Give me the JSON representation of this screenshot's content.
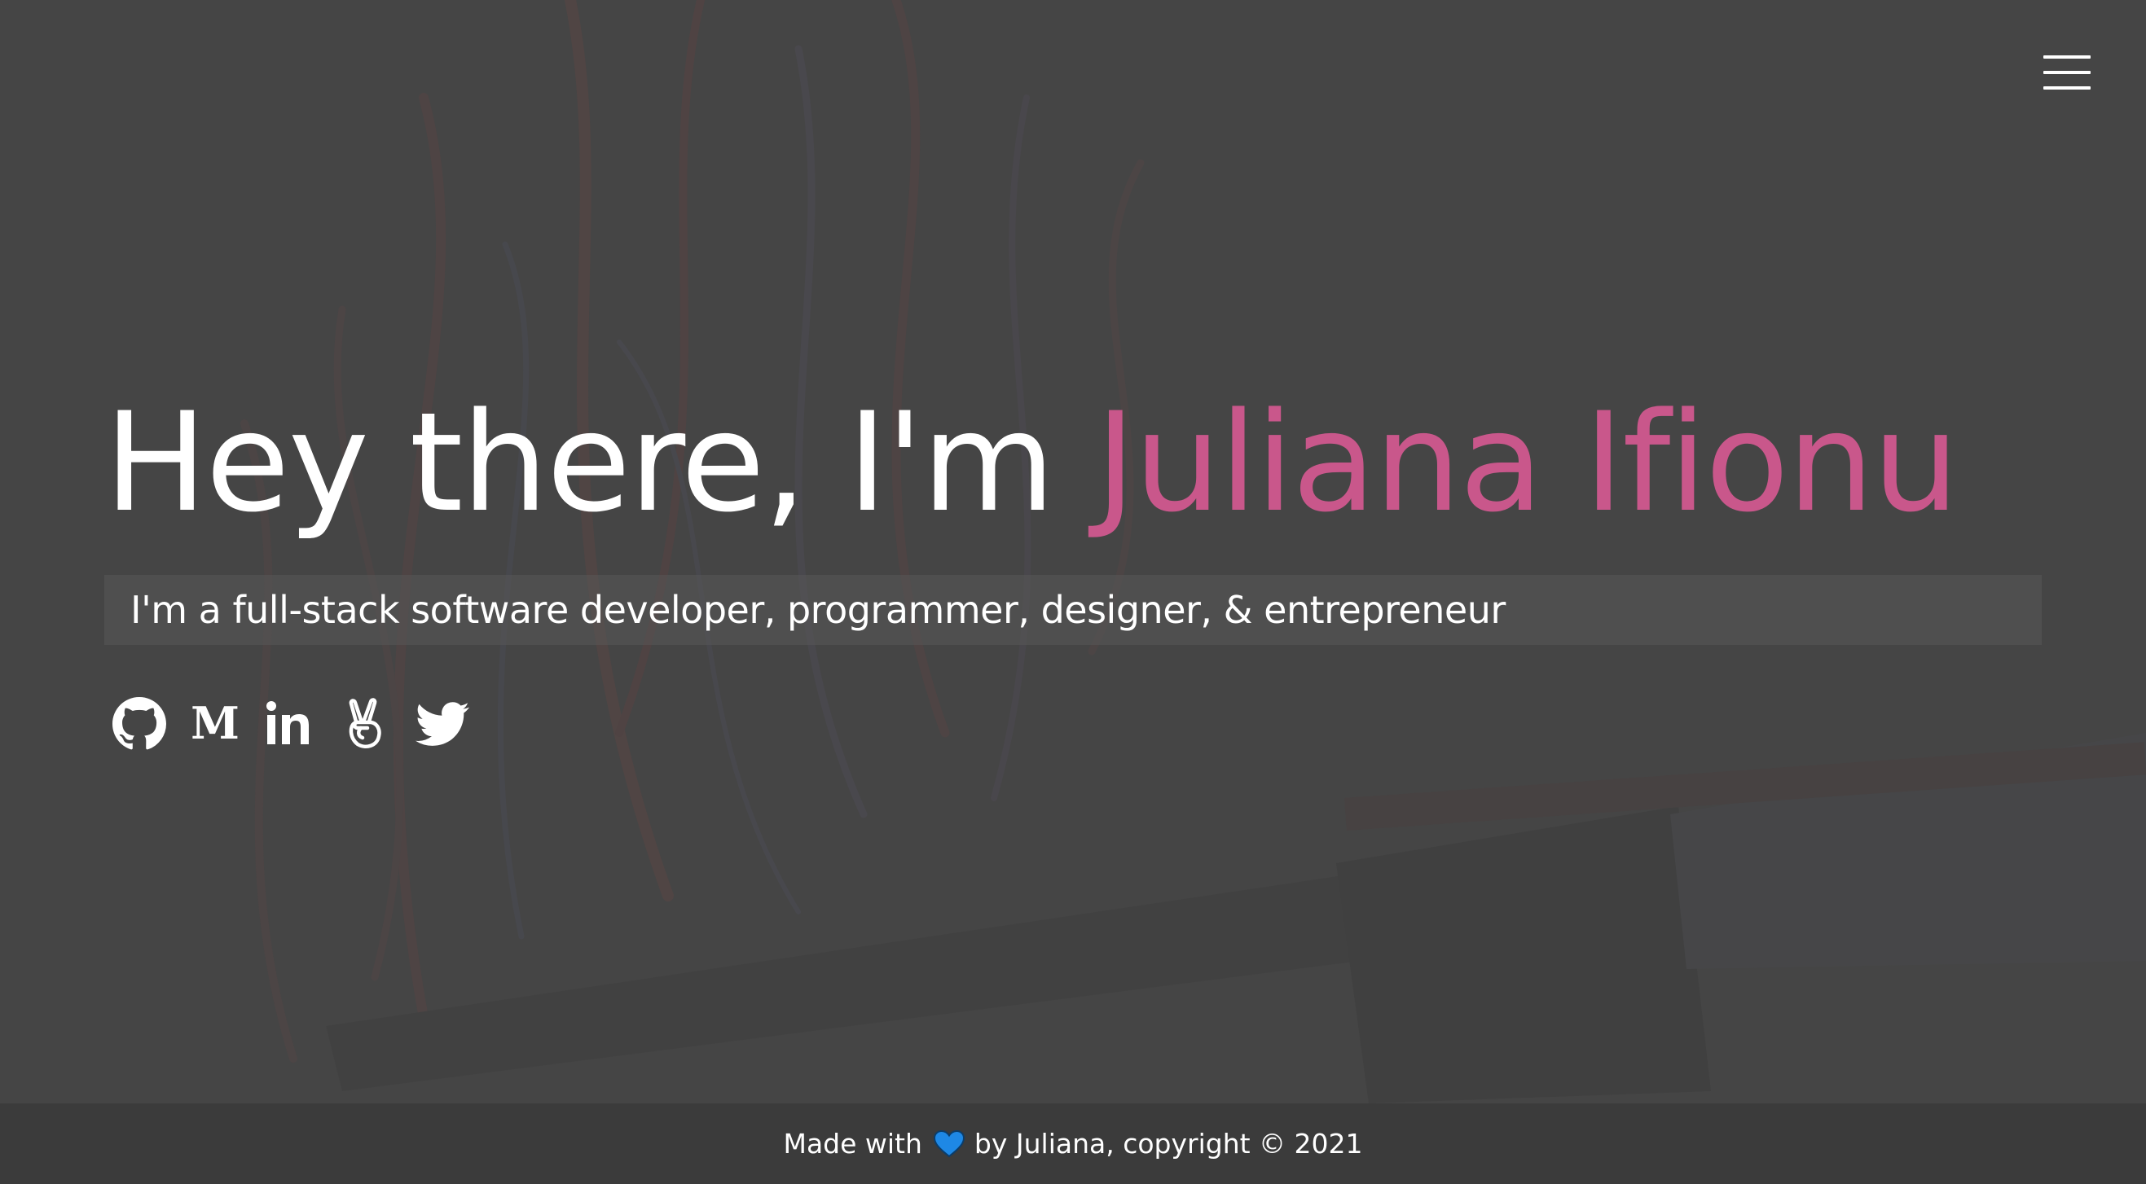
{
  "header": {
    "menu_icon": "hamburger-menu-icon"
  },
  "hero": {
    "greeting": "Hey there, I'm ",
    "name": "Juliana Ifionu",
    "subtitle": "I'm a full-stack software developer, programmer, designer, & entrepreneur"
  },
  "socials": [
    {
      "icon": "github-icon",
      "label": "GitHub"
    },
    {
      "icon": "medium-icon",
      "label": "Medium"
    },
    {
      "icon": "linkedin-icon",
      "label": "LinkedIn"
    },
    {
      "icon": "angellist-icon",
      "label": "AngelList"
    },
    {
      "icon": "twitter-icon",
      "label": "Twitter"
    }
  ],
  "footer": {
    "made_with": "Made with",
    "heart_icon": "blue-heart-icon",
    "by_text": "by Juliana, copyright © 2021"
  },
  "colors": {
    "background": "#454545",
    "accent": "#c9578b",
    "footer": "#3b3b3b",
    "heart": "#1e88e5"
  }
}
